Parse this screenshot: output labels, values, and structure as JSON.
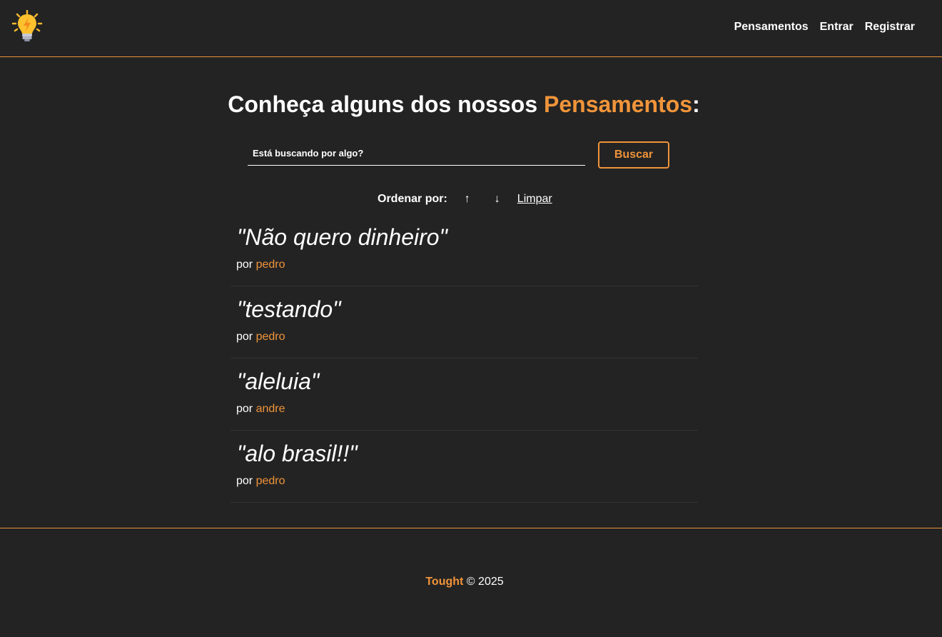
{
  "nav": {
    "logo_icon": "lightbulb-icon",
    "links": [
      {
        "label": "Pensamentos"
      },
      {
        "label": "Entrar"
      },
      {
        "label": "Registrar"
      }
    ]
  },
  "main": {
    "title_prefix": "Conheça alguns dos nossos ",
    "title_accent": "Pensamentos",
    "title_suffix": ":",
    "search": {
      "placeholder": "Está buscando por algo?",
      "value": "",
      "button_label": "Buscar"
    },
    "order": {
      "label": "Ordenar por:",
      "asc_icon": "↑",
      "desc_icon": "↓",
      "clear_label": "Limpar"
    },
    "thoughts": [
      {
        "text": "\"Não quero dinheiro\"",
        "by": "por ",
        "author": "pedro"
      },
      {
        "text": "\"testando\"",
        "by": "por ",
        "author": "pedro"
      },
      {
        "text": "\"aleluia\"",
        "by": "por ",
        "author": "andre"
      },
      {
        "text": "\"alo brasil!!\"",
        "by": "por ",
        "author": "pedro"
      }
    ]
  },
  "footer": {
    "brand": "Tought",
    "copyright": " © 2025"
  },
  "colors": {
    "background": "#232323",
    "accent": "#f0943a",
    "text": "#ffffff"
  }
}
